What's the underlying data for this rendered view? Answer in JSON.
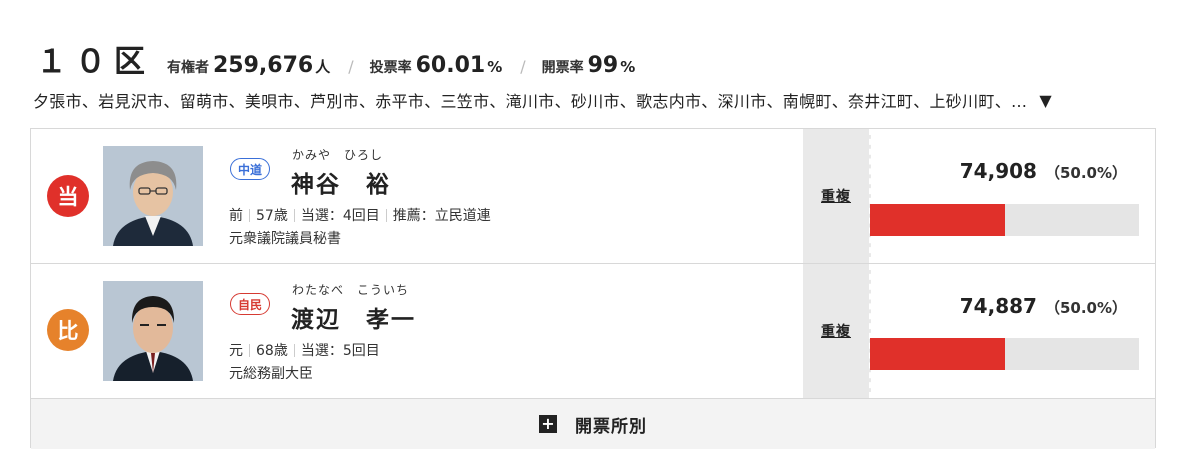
{
  "district": {
    "title": "１０区",
    "voters_label": "有権者",
    "voters_value": "259,676",
    "voters_unit": "人",
    "turnout_label": "投票率",
    "turnout_value": "60.01",
    "turnout_unit": "%",
    "counted_label": "開票率",
    "counted_value": "99",
    "counted_unit": "%",
    "areas": "夕張市、岩見沢市、留萌市、美唄市、芦別市、赤平市、三笠市、滝川市、砂川市、歌志内市、深川市、南幌町、奈井江町、上砂川町、…",
    "areas_toggle": "▼"
  },
  "candidates": [
    {
      "status": "当",
      "status_color": "#e0302a",
      "party": "中道",
      "party_color": "#3a6fd8",
      "kana": "かみや　ひろし",
      "name": "神谷　裕",
      "incumbency": "前",
      "age": "57歳",
      "wins": "当選：4回目",
      "endorsement": "推薦：立民道連",
      "career": "元衆議院議員秘書",
      "duplicate": "重複",
      "votes": "74,908",
      "percent": "（50.0%）",
      "share": 0.5
    },
    {
      "status": "比",
      "status_color": "#e6822b",
      "party": "自民",
      "party_color": "#d63a32",
      "kana": "わたなべ　こういち",
      "name": "渡辺　孝一",
      "incumbency": "元",
      "age": "68歳",
      "wins": "当選：5回目",
      "career": "元総務副大臣",
      "duplicate": "重複",
      "votes": "74,887",
      "percent": "（50.0%）",
      "share": 0.5
    }
  ],
  "footer": {
    "icon": "plus-icon",
    "label": "開票所別"
  },
  "colors": {
    "bar": "#e0302a",
    "bar_track": "#e5e5e5"
  }
}
